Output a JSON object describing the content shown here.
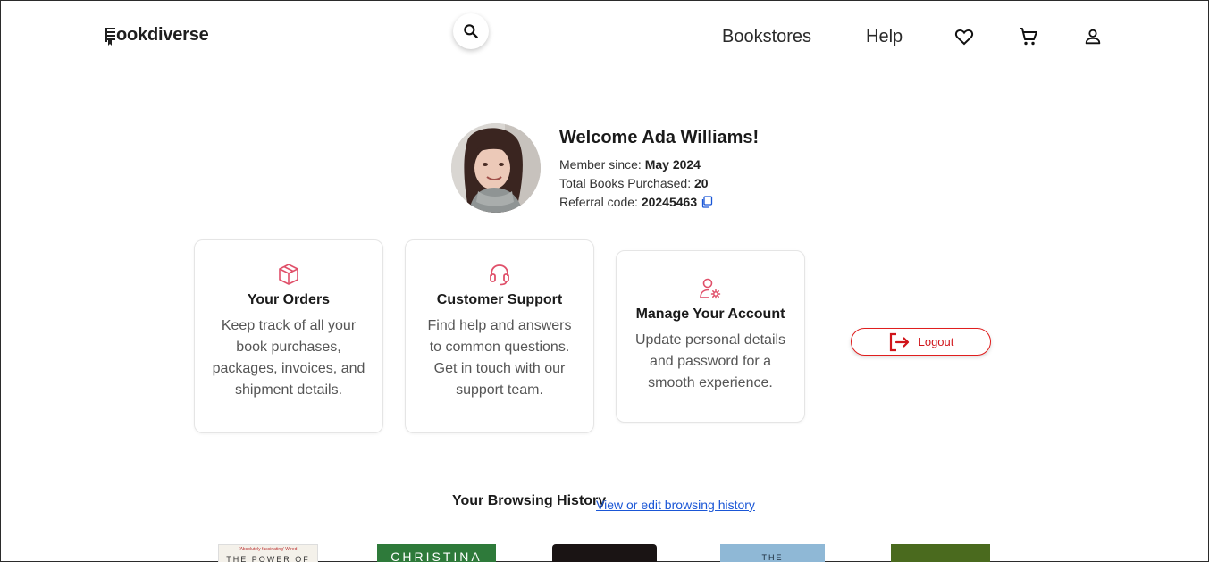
{
  "header": {
    "logo_text": "ookdiverse",
    "nav": [
      {
        "label": "Bookstores"
      },
      {
        "label": "Help"
      }
    ],
    "icons": [
      "search-icon",
      "heart-icon",
      "cart-icon",
      "user-icon"
    ]
  },
  "profile": {
    "welcome": "Welcome Ada Williams!",
    "member_since_label": "Member since:",
    "member_since_value": "May 2024",
    "books_label": "Total Books Purchased:",
    "books_value": "20",
    "referral_label": "Referral code:",
    "referral_value": "20245463"
  },
  "cards": [
    {
      "title": "Your Orders",
      "description": "Keep track of all your book purchases, packages, invoices, and shipment details.",
      "icon": "box-icon"
    },
    {
      "title": "Customer Support",
      "description": "Find help and answers to common questions. Get in touch with our support team.",
      "icon": "headset-icon"
    },
    {
      "title": "Manage Your Account",
      "description": "Update personal details and password for a smooth experience.",
      "icon": "user-settings-icon"
    }
  ],
  "logout_label": "Logout",
  "history": {
    "title": "Your Browsing History",
    "link": "View or edit browsing history",
    "books": [
      {
        "cover_text": "THE POWER OF",
        "note": "'Absolutely fascinating' Wired"
      },
      {
        "cover_text": "CHRISTINA"
      },
      {
        "cover_text": ""
      },
      {
        "cover_text": "THE"
      },
      {
        "cover_text": ""
      }
    ]
  },
  "colors": {
    "accent_red": "#e01e1e",
    "icon_pink": "#e0506a",
    "link_blue": "#1a56d6"
  }
}
